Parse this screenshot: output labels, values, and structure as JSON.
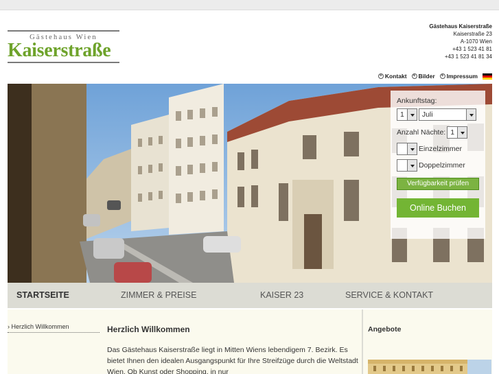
{
  "logo": {
    "small": "Gästehaus Wien",
    "big": "Kaiserstraße"
  },
  "address": {
    "name": "Gästehaus Kaiserstraße",
    "street": "Kaiserstraße 23",
    "city": "A-1070 Wien",
    "phone": "+43 1 523 41 81",
    "fax": "+43 1 523 41 81 34"
  },
  "topnav": {
    "items": [
      "Kontakt",
      "Bilder",
      "Impressum"
    ]
  },
  "booking": {
    "arrival_label": "Ankunftstag:",
    "day": "1",
    "month": "Juli",
    "nights_label": "Anzahl Nächte:",
    "nights": "1",
    "single_label": "Einzelzimmer",
    "single_value": "",
    "double_label": "Doppelzimmer",
    "double_value": "",
    "check_button": "Verfügbarkeit prüfen",
    "book_button": "Online Buchen"
  },
  "mainnav": {
    "items": [
      "STARTSEITE",
      "ZIMMER & PREISE",
      "KAISER 23",
      "SERVICE & KONTAKT"
    ]
  },
  "sidebar": {
    "item": "Herzlich Willkommen"
  },
  "content": {
    "title": "Herzlich Willkommen",
    "text": "Das Gästehaus Kaiserstraße liegt in Mitten Wiens lebendigem 7. Bezirk. Es bietet Ihnen den idealen Ausgangspunkt für Ihre Streifzüge durch die Weltstadt Wien. Ob Kunst oder Shopping, in nur"
  },
  "right": {
    "title": "Angebote"
  },
  "colors": {
    "brand_green": "#6ea32b",
    "button_green": "#73b534",
    "nav_bg": "#dcdcd4",
    "content_bg": "#fbfaee"
  },
  "icons": {
    "topnav": "circle-plus-icon",
    "flag": "german-flag-icon"
  }
}
